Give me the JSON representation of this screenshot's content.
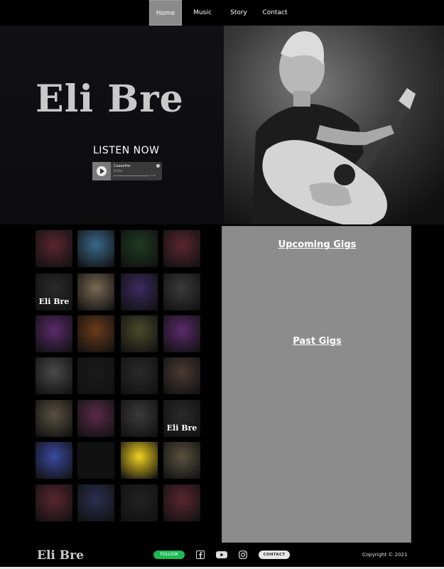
{
  "nav": {
    "items": [
      {
        "label": "Home",
        "active": true
      },
      {
        "label": "Music",
        "active": false
      },
      {
        "label": "Story",
        "active": false
      },
      {
        "label": "Contact",
        "active": false
      }
    ]
  },
  "hero": {
    "logo": "Eli Bre",
    "listen_label": "LISTEN NOW",
    "player": {
      "title": "Ceasefire",
      "artist": "Eli Bre",
      "time": "0:00"
    }
  },
  "gallery": {
    "thumbs": [
      {
        "icon": "guitarist-stage-photo",
        "color": "#5a2630"
      },
      {
        "icon": "blue-storefront-photo",
        "color": "#3a6a8a"
      },
      {
        "icon": "green-stage-photo",
        "color": "#1f3a22"
      },
      {
        "icon": "guitarist-stage-photo",
        "color": "#5a2630"
      },
      {
        "icon": "gig-poster",
        "color": "#2a2a2a",
        "text": "Eli Bre"
      },
      {
        "icon": "acoustic-jam-poster",
        "color": "#7a6a54"
      },
      {
        "icon": "purple-stage-photo",
        "color": "#3a2a60"
      },
      {
        "icon": "bar-interior-photo",
        "color": "#3a3a3a"
      },
      {
        "icon": "cambridge-folk-club-logo",
        "color": "#5a2a6a"
      },
      {
        "icon": "warm-stage-photo",
        "color": "#6a3a1a"
      },
      {
        "icon": "green-performer-photo",
        "color": "#4a4a2a"
      },
      {
        "icon": "cambridge-folk-club-logo",
        "color": "#5a2a6a"
      },
      {
        "icon": "guitarist-bar-photo",
        "color": "#4a4a4a"
      },
      {
        "icon": "gig-poster-bw",
        "color": "#1a1a1a"
      },
      {
        "icon": "spotlight-photo",
        "color": "#2a2a2a"
      },
      {
        "icon": "street-performer-photo",
        "color": "#4a3a34"
      },
      {
        "icon": "chalkboard-sign-photo",
        "color": "#5a5040"
      },
      {
        "icon": "crowd-pink-photo",
        "color": "#5a2a4a"
      },
      {
        "icon": "bar-interior-photo",
        "color": "#3a3a3a"
      },
      {
        "icon": "gig-poster",
        "color": "#2a2a2a",
        "text": "Eli Bre"
      },
      {
        "icon": "pink-blue-artwork",
        "color": "#3a4aa0"
      },
      {
        "icon": "white-logo-badge",
        "color": "#111111"
      },
      {
        "icon": "yellow-bird-poster",
        "color": "#f0d020"
      },
      {
        "icon": "chalkboard-sign-photo",
        "color": "#5a5040"
      },
      {
        "icon": "guitarist-stage-photo",
        "color": "#5a2630"
      },
      {
        "icon": "blue-audience-photo",
        "color": "#2a3050"
      },
      {
        "icon": "portrait-bw-photo",
        "color": "#222222"
      },
      {
        "icon": "guitarist-stage-photo",
        "color": "#5a2630"
      }
    ]
  },
  "gigs": {
    "upcoming_label": "Upcoming Gigs",
    "past_label": "Past Gigs"
  },
  "footer": {
    "logo": "Eli Bre",
    "follow_label": "FOLLOW",
    "contact_label": "CONTACT",
    "copyright": "Copyright © 2021"
  }
}
